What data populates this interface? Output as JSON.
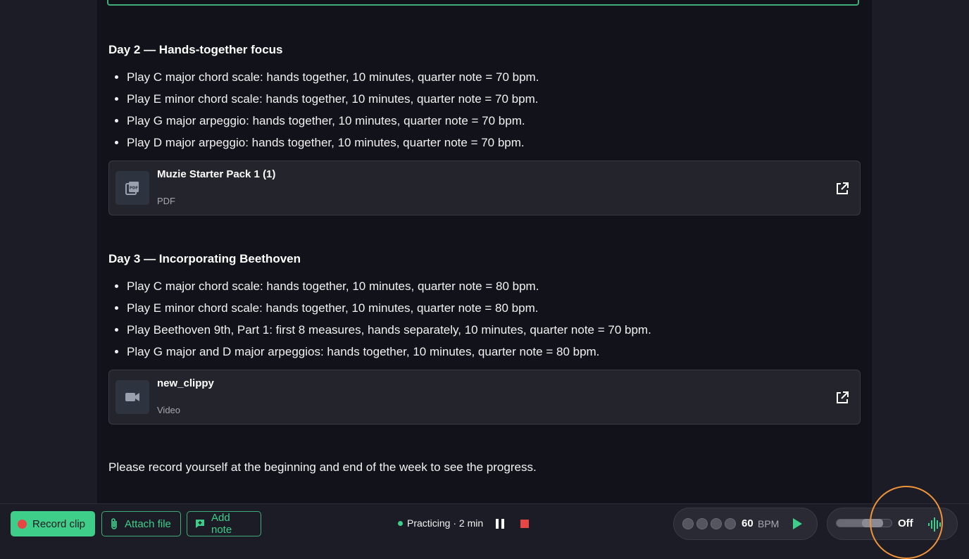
{
  "lesson": {
    "days": [
      {
        "heading": "Day 2 — Hands-together focus",
        "tasks": [
          "Play C major chord scale: hands together, 10 minutes, quarter note = 70 bpm.",
          "Play E minor chord scale: hands together, 10 minutes, quarter note = 70 bpm.",
          "Play G major arpeggio: hands together, 10 minutes, quarter note = 70 bpm.",
          "Play D major arpeggio: hands together, 10 minutes, quarter note = 70 bpm."
        ],
        "attachment": {
          "name": "Muzie Starter Pack 1 (1)",
          "type": "PDF",
          "icon": "pdf-icon"
        }
      },
      {
        "heading": "Day 3 — Incorporating Beethoven",
        "tasks": [
          "Play C major chord scale: hands together, 10 minutes, quarter note = 80 bpm.",
          "Play E minor chord scale: hands together, 10 minutes, quarter note = 80 bpm.",
          "Play Beethoven 9th, Part 1: first 8 measures, hands separately, 10 minutes, quarter note = 70 bpm.",
          "Play G major and D major arpeggios: hands together, 10 minutes, quarter note = 80 bpm."
        ],
        "attachment": {
          "name": "new_clippy",
          "type": "Video",
          "icon": "video-camera-icon"
        }
      }
    ],
    "closing_note": "Please record yourself at the beginning and end of the week to see the progress."
  },
  "toolbar": {
    "record_label": "Record clip",
    "attach_label": "Attach file",
    "note_label": "Add note",
    "status_text": "Practicing · 2 min",
    "metronome": {
      "beats": 4,
      "bpm": "60",
      "bpm_unit": "BPM"
    },
    "drone": {
      "state_label": "Off",
      "level": 0.55
    }
  },
  "colors": {
    "accent": "#3fce8a",
    "record_dot": "#e84545",
    "highlight_ring": "#f0933a",
    "background": "#12121a"
  }
}
